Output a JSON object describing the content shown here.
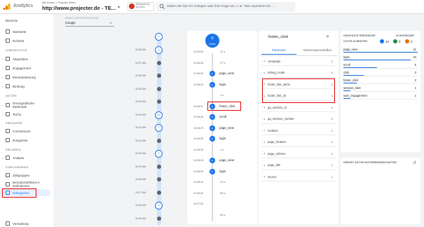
{
  "header": {
    "app_name": "Analytics",
    "account_path": "Alle Konten > Projecter Seiten",
    "property_name": "http://www.projecter.de - TE...",
    "extension_label": "Enhanced by Da Vinci",
    "search_placeholder": "Geben Sie hier Ihr Anliegen oder Ihre Frage ein, z. B. \"Wie exportiere ich ..."
  },
  "filters": {
    "label": "DEBUG-GERÄTEPROGRAMM",
    "device_value": "Google",
    "side_label": "Bereiche"
  },
  "sidebar": {
    "items": [
      {
        "label": "Startseite"
      },
      {
        "label": "Echtzeit"
      },
      {
        "section": "LEBENSZYKLUS"
      },
      {
        "label": "Akquisition"
      },
      {
        "label": "Engagement"
      },
      {
        "label": "Monetarisierung"
      },
      {
        "label": "Bindung"
      },
      {
        "section": "NUTZER"
      },
      {
        "label": "Demografische Merkmale"
      },
      {
        "label": "Techn."
      },
      {
        "section": "EREIGNISSE"
      },
      {
        "label": "Conversions"
      },
      {
        "label": "Ereignisse"
      },
      {
        "section": "ERKUNDEN"
      },
      {
        "label": "Analyse"
      },
      {
        "section": "KONFIGURIEREN"
      },
      {
        "label": "Zielgruppen"
      },
      {
        "label": "Benutzerdefiniert e Definitionen"
      },
      {
        "label": "DebugView"
      },
      {
        "label": "Verwaltung"
      }
    ]
  },
  "minutes": {
    "top_count": "0",
    "rows": [
      {
        "time": "10:38 AM",
        "count": "4"
      },
      {
        "time": "10:37 AM",
        "count": ""
      },
      {
        "time": "10:36 AM",
        "count": ""
      },
      {
        "time": "10:35 AM",
        "count": ""
      },
      {
        "time": "10:34 AM",
        "count": ""
      },
      {
        "time": "10:33 AM",
        "count": "10"
      },
      {
        "time": "10:32 AM",
        "count": "2"
      },
      {
        "time": "10:31 AM",
        "count": ""
      },
      {
        "time": "10:30 AM",
        "count": "2"
      },
      {
        "time": "10:29 AM",
        "count": ""
      },
      {
        "time": "10:28 AM",
        "count": ""
      },
      {
        "time": "10:27 AM",
        "count": ""
      },
      {
        "time": "10:26 AM",
        "count": "3"
      },
      {
        "time": "10:25 AM",
        "count": ""
      }
    ]
  },
  "events": {
    "now_count": "0",
    "now_label": "Vorher",
    "rows": [
      {
        "time": "10:39:00",
        "gap": "11 s"
      },
      {
        "time": "10:38:45",
        "gap": "27 s"
      },
      {
        "time": "10:38:33",
        "event": "page_view"
      },
      {
        "time": "10:38:33",
        "event": "login"
      },
      {
        "time": "",
        "gap": "1 s"
      },
      {
        "time": "10:38:31",
        "event": "footer_click"
      },
      {
        "time": "10:38:30",
        "event": "scroll"
      },
      {
        "time": "10:38:29",
        "event": "page_view"
      },
      {
        "time": "10:38:25",
        "event": "login"
      },
      {
        "time": "10:38:25",
        "gap": "2 s"
      },
      {
        "time": "10:38:25",
        "event": "page_view"
      },
      {
        "time": "10:38:25",
        "event": "login"
      },
      {
        "time": "10:38:10",
        "gap": "23 s"
      },
      {
        "time": "10:38:00",
        "gap": "60 s"
      },
      {
        "time": "10:37:00",
        "gap": ""
      },
      {
        "time": "",
        "gap": "60 s"
      }
    ]
  },
  "params": {
    "title": "footer_click",
    "tab_parameter": "Parameter",
    "tab_user": "Nutzereigenschaften",
    "rows": [
      {
        "name": "campaign",
        "count": "1"
      },
      {
        "name": "debug_mode",
        "count": "1"
      },
      {
        "name": "footer_link_name",
        "count": "1"
      },
      {
        "name": "footer_link_url",
        "count": "1"
      },
      {
        "name": "ga_session_id",
        "count": "1"
      },
      {
        "name": "ga_session_number",
        "count": "1"
      },
      {
        "name": "medium",
        "count": "1"
      },
      {
        "name": "page_location",
        "count": "1"
      },
      {
        "name": "page_referrer",
        "count": "1"
      },
      {
        "name": "page_title",
        "count": "1"
      },
      {
        "name": "source",
        "count": "1"
      }
    ]
  },
  "top_events": {
    "title": "HÄUFIGSTE EREIGNISSE",
    "tag": "34 INSGESAMT",
    "last_label": "LETZTE 30 MINUTEN",
    "stats": {
      "blue": "34",
      "green": "0",
      "orange": "0"
    },
    "rows": [
      {
        "name": "page_view",
        "count": "11"
      },
      {
        "name": "login",
        "count": "10"
      },
      {
        "name": "scroll",
        "count": "5"
      },
      {
        "name": "click",
        "count": "3"
      },
      {
        "name": "footer_click",
        "count": "2"
      },
      {
        "name": "session_start",
        "count": "1"
      },
      {
        "name": "user_engagement",
        "count": "1"
      }
    ]
  },
  "user_props": {
    "title": "DERZEIT AKTIVE NUTZEREIGENSCHAFTEN"
  },
  "colors": {
    "accent": "#1a73e8",
    "highlight": "#e00000"
  }
}
